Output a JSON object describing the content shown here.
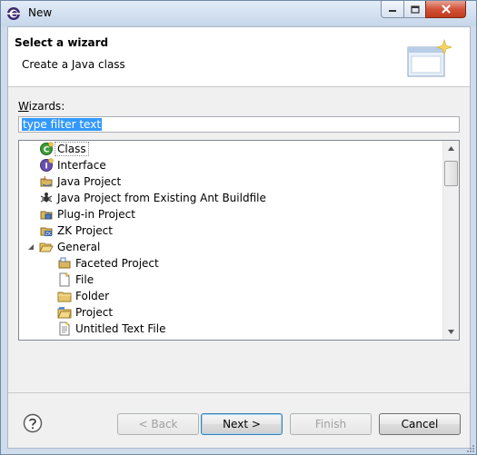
{
  "window": {
    "title": "New"
  },
  "banner": {
    "title": "Select a wizard",
    "subtitle": "Create a Java class"
  },
  "wizards": {
    "label_prefix": "W",
    "label_rest": "izards:",
    "filter_value": "type filter text"
  },
  "tree": {
    "items": [
      {
        "label": "Class",
        "icon": "java-class-icon",
        "indent": 0,
        "selected": true
      },
      {
        "label": "Interface",
        "icon": "java-interface-icon",
        "indent": 0
      },
      {
        "label": "Java Project",
        "icon": "java-project-icon",
        "indent": 0
      },
      {
        "label": "Java Project from Existing Ant Buildfile",
        "icon": "ant-icon",
        "indent": 0
      },
      {
        "label": "Plug-in Project",
        "icon": "plugin-project-icon",
        "indent": 0
      },
      {
        "label": "ZK Project",
        "icon": "zk-project-icon",
        "indent": 0
      },
      {
        "label": "General",
        "icon": "folder-open-icon",
        "indent": 0,
        "expanded": true
      },
      {
        "label": "Faceted Project",
        "icon": "faceted-project-icon",
        "indent": 1
      },
      {
        "label": "File",
        "icon": "file-icon",
        "indent": 1
      },
      {
        "label": "Folder",
        "icon": "folder-icon",
        "indent": 1
      },
      {
        "label": "Project",
        "icon": "project-icon",
        "indent": 1
      },
      {
        "label": "Untitled Text File",
        "icon": "text-file-icon",
        "indent": 1
      }
    ]
  },
  "buttons": {
    "back": "< Back",
    "next": "Next >",
    "finish": "Finish",
    "cancel": "Cancel"
  },
  "colors": {
    "selection": "#3399ff",
    "titlebar": "#d4e1f0",
    "close_button": "#c23a1c"
  }
}
